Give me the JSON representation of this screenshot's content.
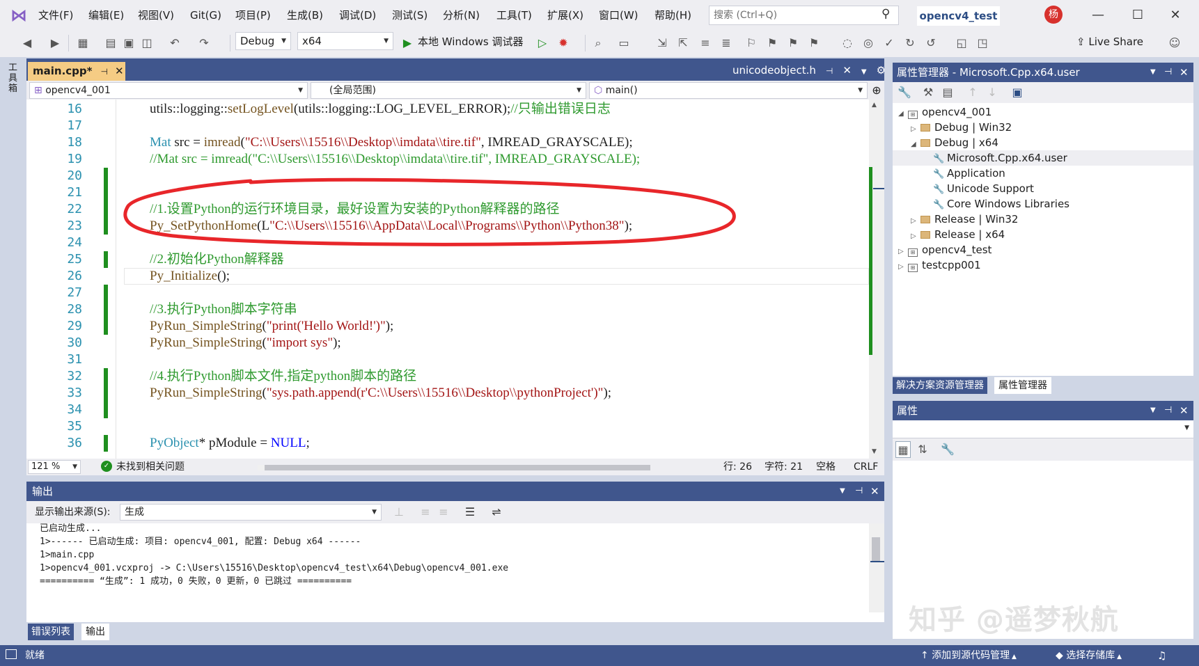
{
  "menu": [
    "文件(F)",
    "编辑(E)",
    "视图(V)",
    "Git(G)",
    "项目(P)",
    "生成(B)",
    "调试(D)",
    "测试(S)",
    "分析(N)",
    "工具(T)",
    "扩展(X)",
    "窗口(W)",
    "帮助(H)"
  ],
  "search_placeholder": "搜索 (Ctrl+Q)",
  "project_name": "opencv4_test",
  "avatar_text": "杨",
  "toolbar": {
    "config": "Debug",
    "platform": "x64",
    "debugger": "本地 Windows 调试器",
    "live_share": "Live Share"
  },
  "toolbox_label": "工具箱",
  "editor": {
    "tab_active": "main.cpp*",
    "tab_other": "unicodeobject.h",
    "nav_project": "opencv4_001",
    "nav_scope": "(全局范围)",
    "nav_func": "main()",
    "line_numbers": [
      "16",
      "17",
      "18",
      "19",
      "20",
      "21",
      "22",
      "23",
      "24",
      "25",
      "26",
      "27",
      "28",
      "29",
      "30",
      "31",
      "32",
      "33",
      "34",
      "35",
      "36"
    ],
    "code": {
      "l16a": "utils::logging::",
      "l16b": "setLogLevel",
      "l16c": "(utils::logging::LOG_LEVEL_ERROR);",
      "l16d": "//只输出错误日志",
      "l18a": "Mat",
      "l18b": " src = ",
      "l18c": "imread",
      "l18d": "(",
      "l18e": "\"C:\\\\Users\\\\15516\\\\Desktop\\\\imdata\\\\tire.tif\"",
      "l18f": ", IMREAD_GRAYSCALE);",
      "l19": "//Mat src = imread(\"C:\\\\Users\\\\15516\\\\Desktop\\\\imdata\\\\tire.tif\", IMREAD_GRAYSCALE);",
      "l22": "//1.设置Python的运行环境目录，最好设置为安装的Python解释器的路径",
      "l23a": "Py_SetPythonHome",
      "l23b": "(L",
      "l23c": "\"C:\\\\Users\\\\15516\\\\AppData\\\\Local\\\\Programs\\\\Python\\\\Python38\"",
      "l23d": ");",
      "l25": "//2.初始化Python解释器",
      "l26a": "Py_Initialize",
      "l26b": "();",
      "l28": "//3.执行Python脚本字符串",
      "l29a": "PyRun_SimpleString",
      "l29b": "(",
      "l29c": "\"print('Hello World!')\"",
      "l29d": ");",
      "l30a": "PyRun_SimpleString",
      "l30b": "(",
      "l30c": "\"import sys\"",
      "l30d": ");",
      "l32": "//4.执行Python脚本文件,指定python脚本的路径",
      "l33a": "PyRun_SimpleString",
      "l33b": "(",
      "l33c": "\"sys.path.append(r'C:\\\\Users\\\\15516\\\\Desktop\\\\pythonProject')\"",
      "l33d": ");",
      "l36a": "PyObject",
      "l36b": "* pModule = ",
      "l36c": "NULL",
      "l36d": ";"
    },
    "zoom": "121 %",
    "issues": "未找到相关问题",
    "row": "行: 26",
    "col": "字符: 21",
    "spaces": "空格",
    "eol": "CRLF"
  },
  "output": {
    "title": "输出",
    "source_label": "显示输出来源(S):",
    "source_value": "生成",
    "lines": [
      "已启动生成...",
      "1>------ 已启动生成: 项目: opencv4_001, 配置: Debug x64 ------",
      "1>main.cpp",
      "1>opencv4_001.vcxproj -> C:\\Users\\15516\\Desktop\\opencv4_test\\x64\\Debug\\opencv4_001.exe",
      "========== “生成”: 1 成功，0 失败，0 更新，0 已跳过 =========="
    ],
    "tab_errors": "错误列表",
    "tab_output": "输出"
  },
  "property_manager": {
    "title": "属性管理器 - Microsoft.Cpp.x64.user",
    "tree": [
      "opencv4_001",
      "Debug | Win32",
      "Debug | x64",
      "Microsoft.Cpp.x64.user",
      "Application",
      "Unicode Support",
      "Core Windows Libraries",
      "Release | Win32",
      "Release | x64",
      "opencv4_test",
      "testcpp001"
    ],
    "tab_solution": "解决方案资源管理器",
    "tab_props": "属性管理器"
  },
  "properties": {
    "title": "属性"
  },
  "watermark": "知乎 @遥梦秋航",
  "status": {
    "ready": "就绪",
    "add_source": "添加到源代码管理",
    "select_repo": "选择存储库"
  },
  "colors": {
    "accent": "#40568d",
    "active_tab": "#f5cc84",
    "annotation": "#e8262a",
    "change_bar": "#1f8f1f"
  }
}
